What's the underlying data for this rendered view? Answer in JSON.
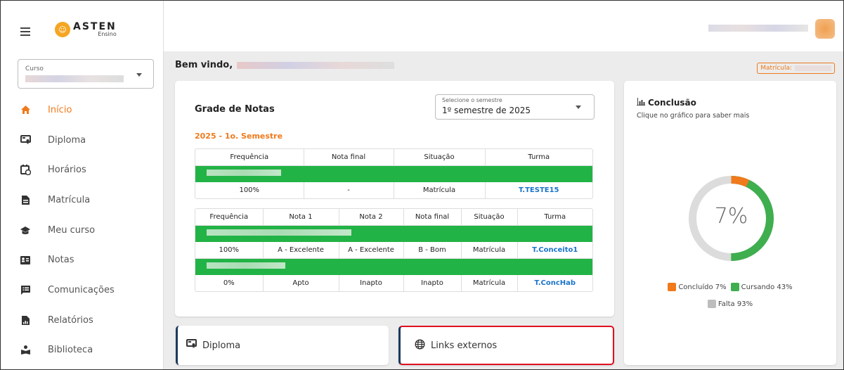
{
  "app": {
    "logo_text": "ASTEN",
    "logo_sub": "Ensino"
  },
  "sidebar": {
    "course_label": "Curso",
    "items": [
      {
        "label": "Início",
        "icon": "home-icon",
        "active": true
      },
      {
        "label": "Diploma",
        "icon": "certificate-icon",
        "active": false
      },
      {
        "label": "Horários",
        "icon": "calendar-clock-icon",
        "active": false
      },
      {
        "label": "Matrícula",
        "icon": "document-icon",
        "active": false
      },
      {
        "label": "Meu curso",
        "icon": "graduation-cap-icon",
        "active": false
      },
      {
        "label": "Notas",
        "icon": "grades-icon",
        "active": false
      },
      {
        "label": "Comunicações",
        "icon": "message-list-icon",
        "active": false
      },
      {
        "label": "Relatórios",
        "icon": "report-chart-icon",
        "active": false
      },
      {
        "label": "Biblioteca",
        "icon": "library-reader-icon",
        "active": false
      }
    ]
  },
  "header": {
    "welcome": "Bem vindo,",
    "matricula_label": "Matrícula:"
  },
  "grades": {
    "title": "Grade de Notas",
    "semester_select_label": "Selecione o semestre",
    "semester_select_value": "1º semestre de 2025",
    "semester_heading": "2025 - 1o. Semestre",
    "table1": {
      "headers": [
        "Frequência",
        "Nota final",
        "Situação",
        "Turma"
      ],
      "row": [
        "100%",
        "-",
        "Matrícula",
        "T.TESTE15"
      ]
    },
    "table2": {
      "headers": [
        "Frequência",
        "Nota 1",
        "Nota 2",
        "Nota final",
        "Situação",
        "Turma"
      ],
      "rows": [
        [
          "100%",
          "A - Excelente",
          "A - Excelente",
          "B - Bom",
          "Matrícula",
          "T.Conceito1"
        ],
        [
          "0%",
          "Apto",
          "Inapto",
          "Inapto",
          "Matrícula",
          "T.ConcHab"
        ]
      ]
    }
  },
  "bottom": {
    "diploma_label": "Diploma",
    "links_label": "Links externos"
  },
  "conclusion": {
    "title": "Conclusão",
    "subtitle": "Clique no gráfico para saber mais",
    "center_value": "7%",
    "legend": {
      "concluido": "Concluído 7%",
      "cursando": "Cursando 43%",
      "falta": "Falta 93%"
    },
    "colors": {
      "concluido": "#f07a1c",
      "cursando": "#3fae4f",
      "falta": "#bdbdbd"
    },
    "segments": {
      "concluido_pct": 7,
      "cursando_pct": 43
    }
  }
}
